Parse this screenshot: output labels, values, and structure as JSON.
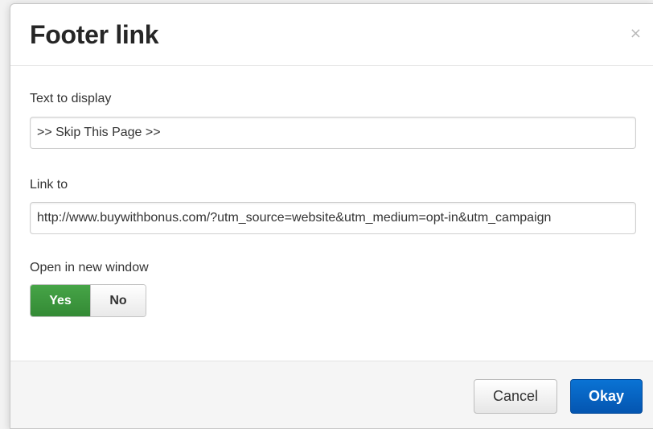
{
  "dialog": {
    "title": "Footer link",
    "close_glyph": "×"
  },
  "form": {
    "text_label": "Text to display",
    "text_value": ">> Skip This Page >>",
    "link_label": "Link to",
    "link_value": "http://www.buywithbonus.com/?utm_source=website&utm_medium=opt-in&utm_campaign",
    "new_window_label": "Open in new window",
    "new_window_options": [
      "Yes",
      "No"
    ],
    "new_window_selected": "Yes"
  },
  "footer": {
    "cancel_label": "Cancel",
    "okay_label": "Okay"
  },
  "colors": {
    "toggle_active": "#3e9a3f",
    "primary_button": "#0762c4"
  },
  "icons": {
    "close": "close-icon"
  }
}
